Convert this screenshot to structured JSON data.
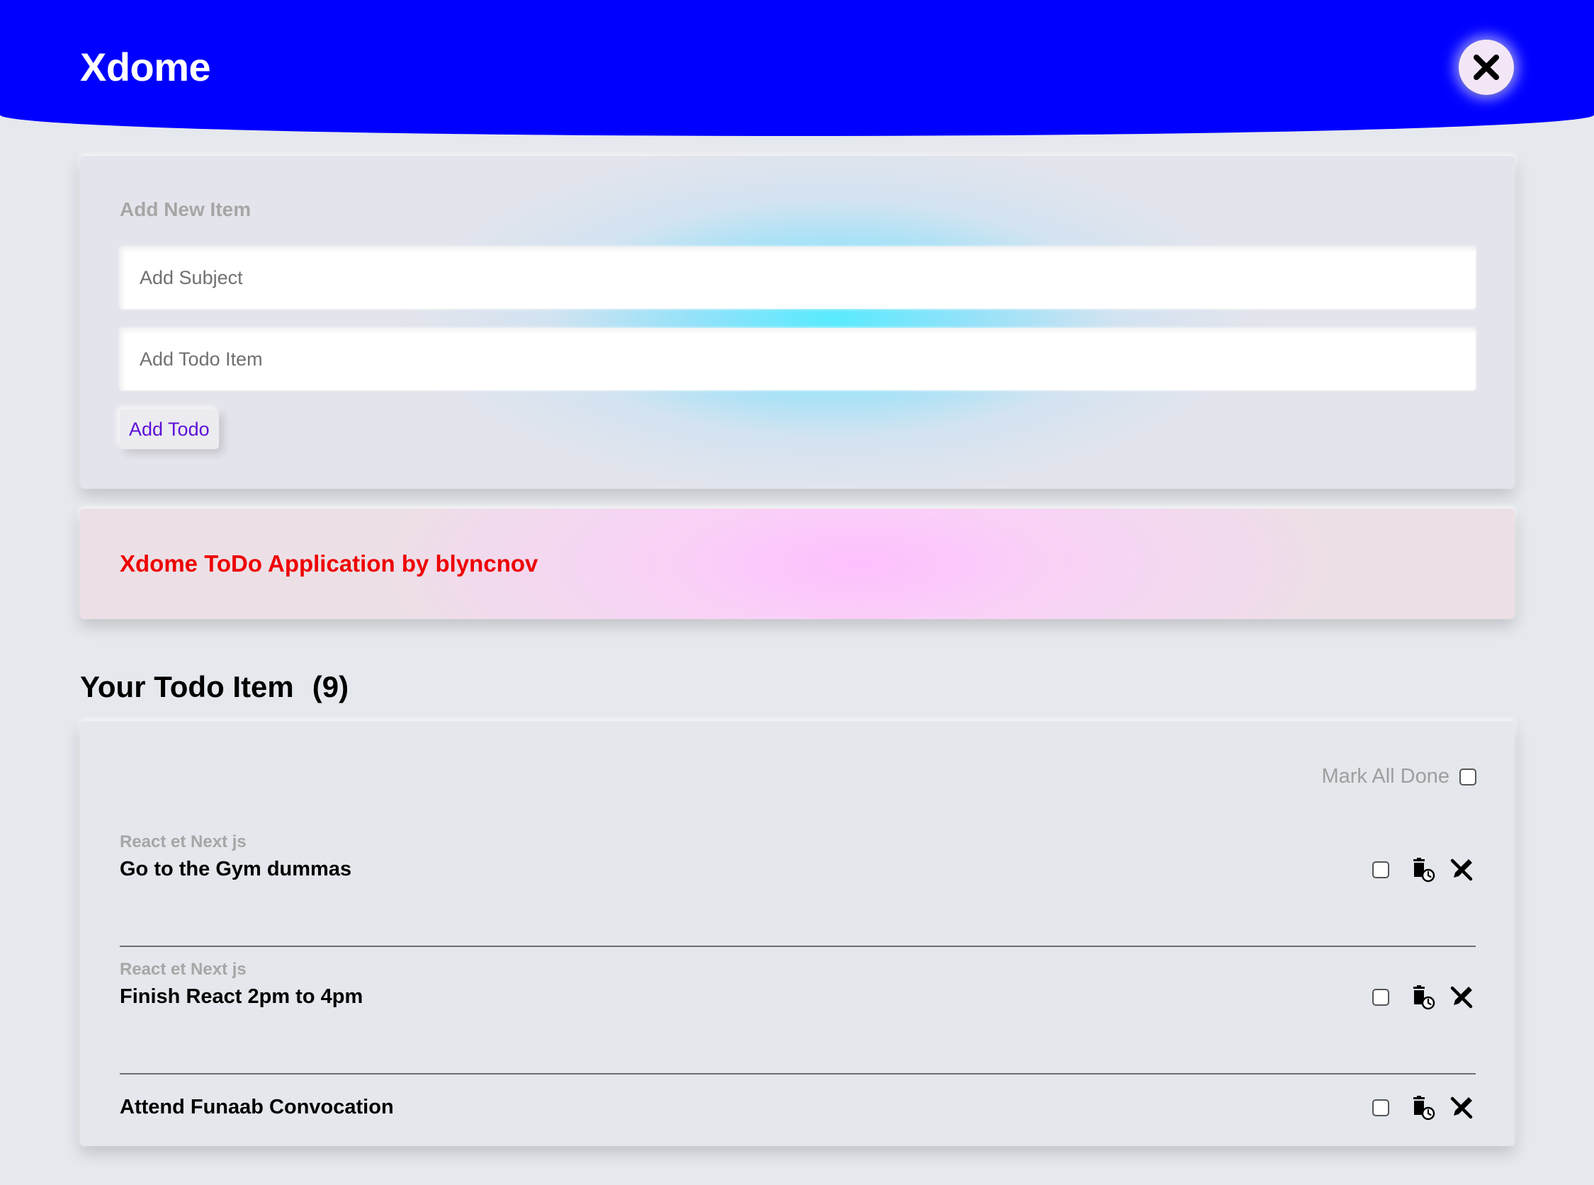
{
  "header": {
    "title": "Xdome",
    "close_icon": "close-icon"
  },
  "add_form": {
    "heading": "Add New Item",
    "subject_placeholder": "Add Subject",
    "subject_value": "",
    "todo_placeholder": "Add Todo Item",
    "todo_value": "",
    "add_button_label": "Add Todo"
  },
  "banner": {
    "text": "Xdome ToDo Application by blyncnov"
  },
  "list": {
    "title": "Your Todo Item",
    "count": "(9)",
    "mark_all_label": "Mark All Done",
    "mark_all_checked": false,
    "items": [
      {
        "subject": "React et Next js",
        "text": "Go to the Gym dummas",
        "done": false
      },
      {
        "subject": "React et Next js",
        "text": "Finish React 2pm to 4pm",
        "done": false
      },
      {
        "subject": "",
        "text": "Attend Funaab Convocation",
        "done": false
      }
    ],
    "item_icons": [
      "delete-clock-icon",
      "edit-off-icon"
    ]
  },
  "colors": {
    "header_bg": "#0000ff",
    "banner_text": "#ee0000",
    "button_text": "#5d0fd6",
    "page_bg": "#e5e8ed"
  }
}
